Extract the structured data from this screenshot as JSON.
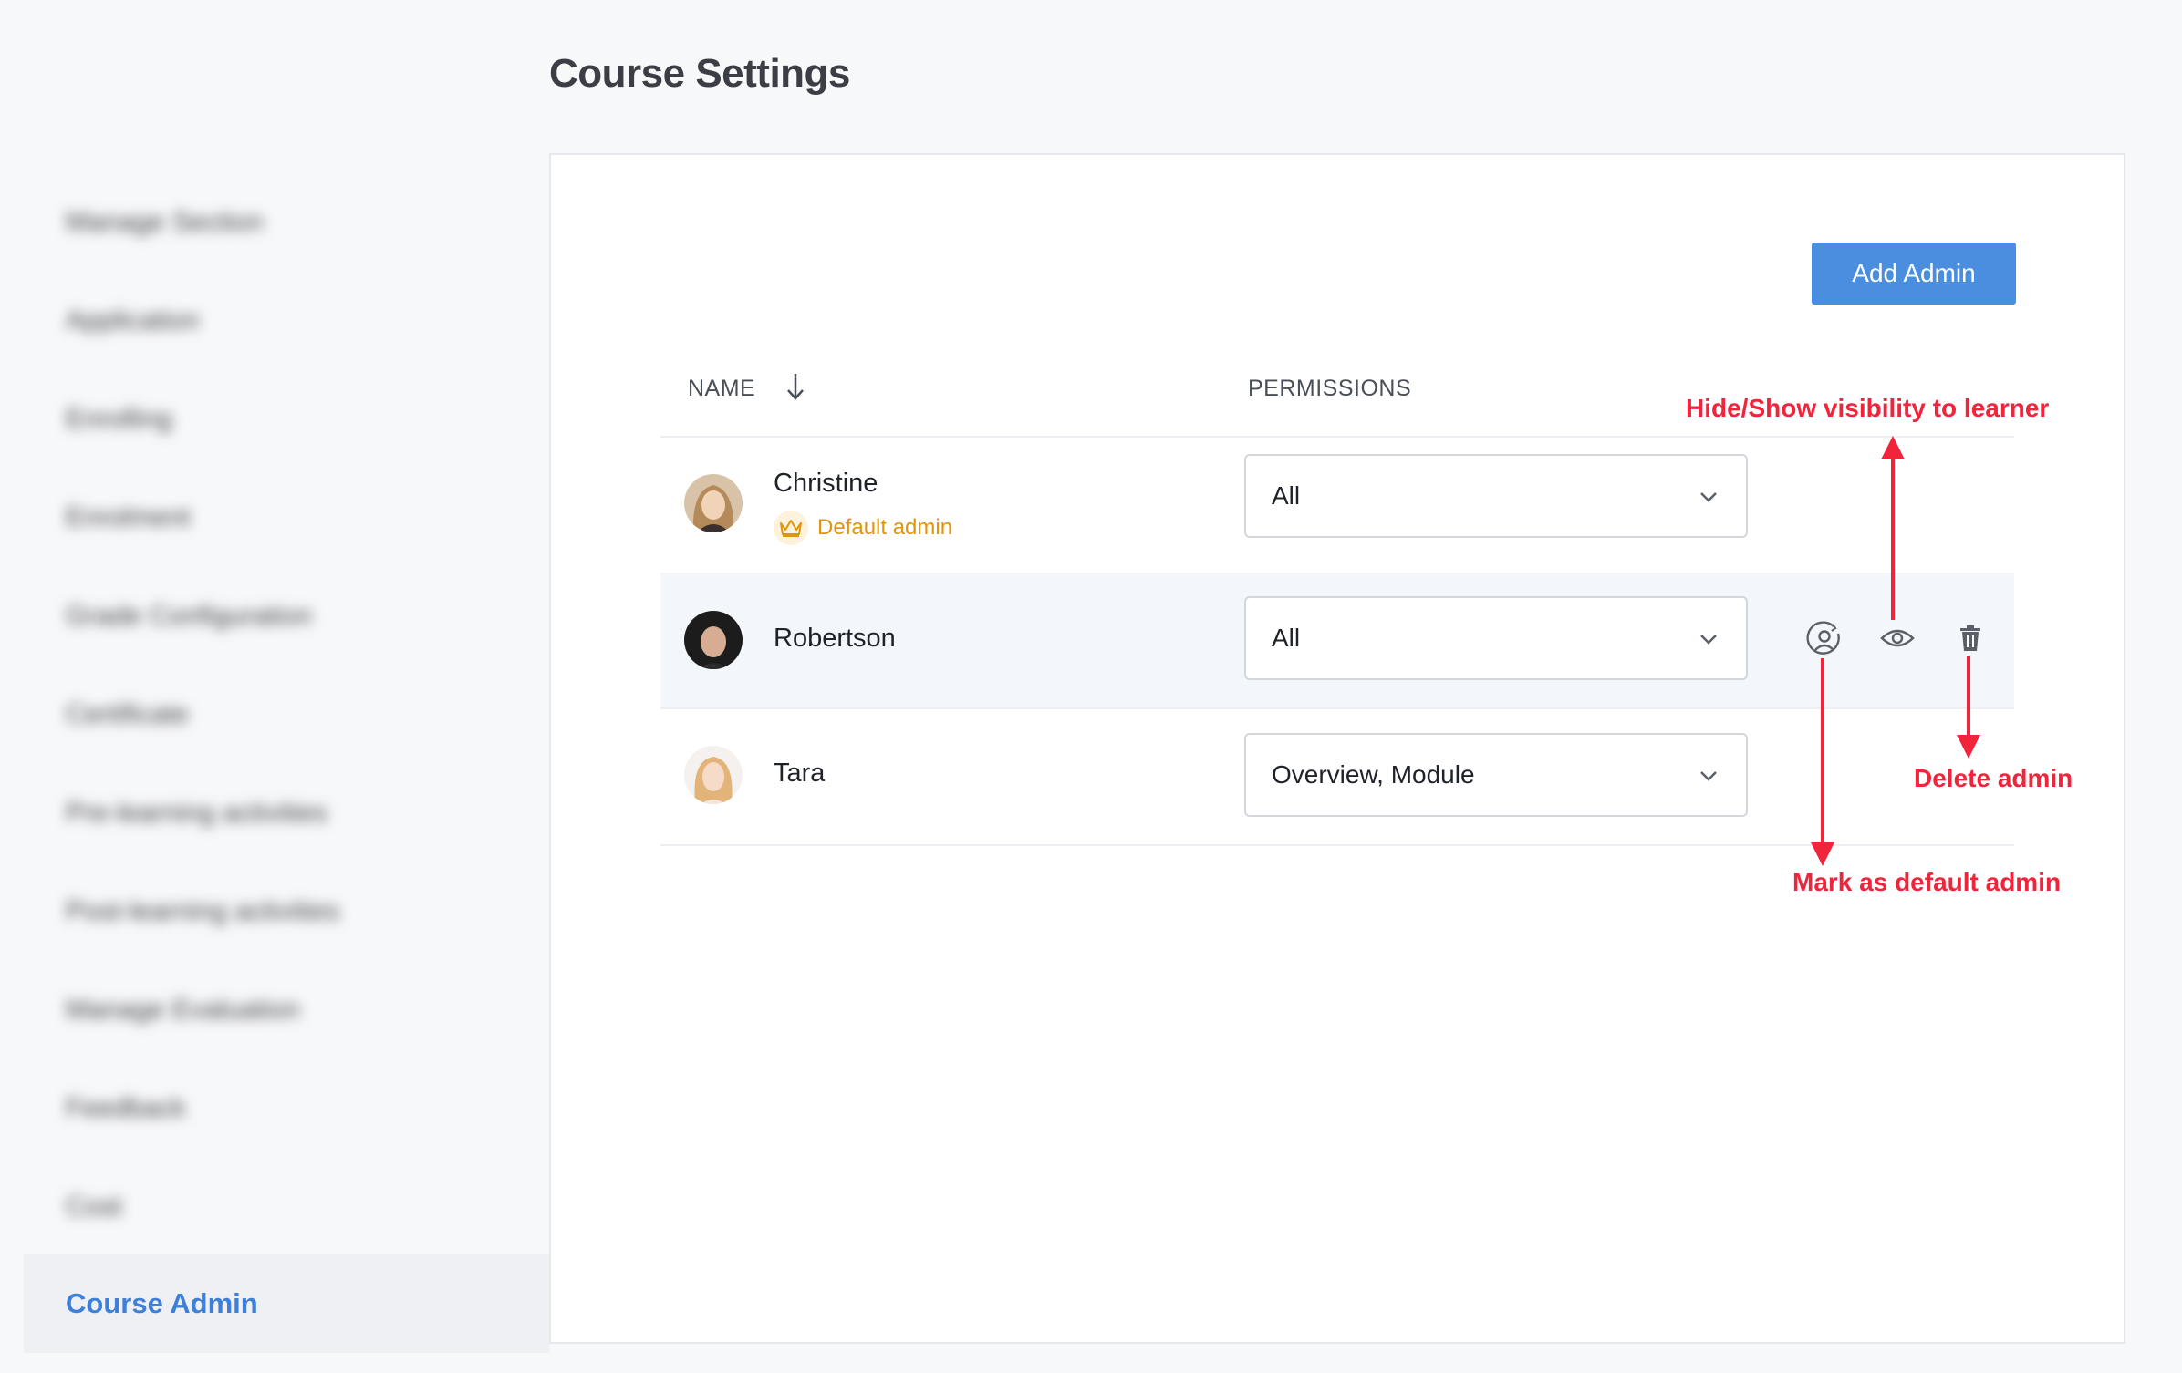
{
  "page": {
    "title": "Course Settings"
  },
  "sidebar": {
    "items": [
      {
        "label": "Manage Section"
      },
      {
        "label": "Application"
      },
      {
        "label": "Enrolling"
      },
      {
        "label": "Enrolment"
      },
      {
        "label": "Grade Configuration"
      },
      {
        "label": "Certificate"
      },
      {
        "label": "Pre-learning activities"
      },
      {
        "label": "Post-learning activities"
      },
      {
        "label": "Manage Evaluation"
      },
      {
        "label": "Feedback"
      },
      {
        "label": "Cost"
      },
      {
        "label": "Course Admin"
      }
    ],
    "active_index": 11
  },
  "toolbar": {
    "add_admin_label": "Add Admin"
  },
  "table": {
    "columns": {
      "name": "NAME",
      "permissions": "PERMISSIONS"
    },
    "rows": [
      {
        "name": "Christine",
        "badge": "Default admin",
        "permissions": "All"
      },
      {
        "name": "Robertson",
        "permissions": "All"
      },
      {
        "name": "Tara",
        "permissions": "Overview, Module"
      }
    ]
  },
  "icons": {
    "sort": "arrow-down-icon",
    "default_admin_badge": "crown-icon",
    "mark_default": "user-circle-refresh-icon",
    "visibility": "eye-icon",
    "delete": "trash-icon",
    "dropdown": "chevron-down-icon"
  },
  "annotations": {
    "visibility": "Hide/Show visibility to learner",
    "delete": "Delete admin",
    "mark_default": "Mark as default admin"
  },
  "colors": {
    "accent": "#4a8ee0",
    "active_sidebar_text": "#3d7fd9",
    "badge": "#e0960b",
    "annotation": "#f0243b",
    "highlight_row": "#f3f6fb"
  }
}
